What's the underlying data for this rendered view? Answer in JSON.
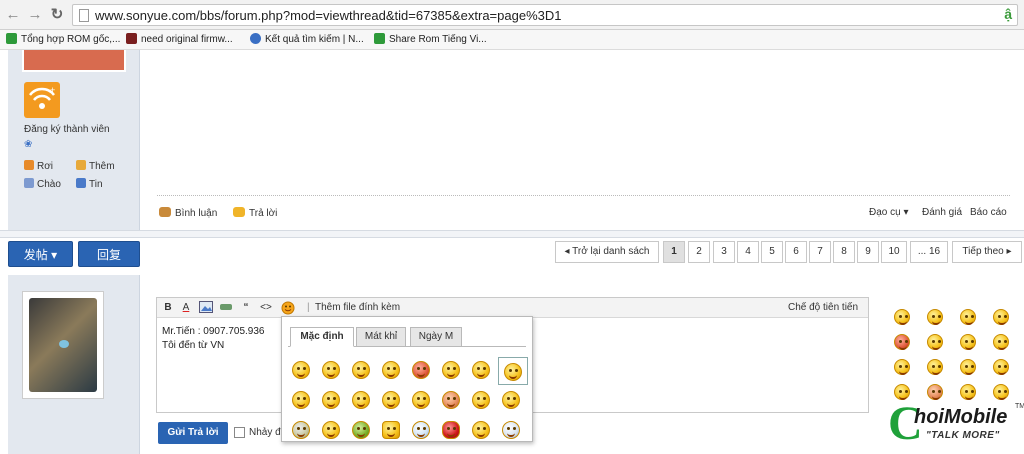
{
  "browser": {
    "url": "www.sonyue.com/bbs/forum.php?mod=viewthread&tid=67385&extra=page%3D1",
    "back_icon": "←",
    "forward_icon": "→",
    "reload_icon": "↻",
    "extension_icon": "ậ"
  },
  "bookmarks": [
    {
      "label": "Tổng hợp ROM gốc,...",
      "color": "#2e9a3a"
    },
    {
      "label": "need original firmw...",
      "color": "#7a1f1f"
    },
    {
      "label": "Kết quả tìm kiếm | N...",
      "color": "#3a6fc4"
    },
    {
      "label": "Share Rom Tiếng Vi...",
      "color": "#2e9a3a"
    }
  ],
  "sidebar": {
    "register_label": "Đăng ký thành viên",
    "flower_icon": "❀",
    "links": [
      "Rơi",
      "Thêm",
      "Chào",
      "Tin"
    ]
  },
  "post_actions": {
    "comment": "Bình luận",
    "reply": "Trả lời",
    "tools": "Đạo cụ",
    "tools_arrow": "▾",
    "rate": "Đánh giá",
    "report": "Báo cáo"
  },
  "buttons": {
    "new_post": "发帖",
    "new_post_arrow": "▾",
    "reply": "回复"
  },
  "pagination": {
    "back_arrow": "◂",
    "back_label": "Trở lại danh sách",
    "pages": [
      "1",
      "2",
      "3",
      "4",
      "5",
      "6",
      "7",
      "8",
      "9",
      "10",
      "... 16"
    ],
    "next_label": "Tiếp theo",
    "next_arrow": "▸"
  },
  "editor": {
    "toolbar": {
      "bold": "B",
      "font_color": "A",
      "quote": "“",
      "code": "<>",
      "attach_label": "Thêm file đính kèm",
      "advanced_label": "Chế độ tiên tiến"
    },
    "lines": [
      "Mr.Tiến : 0907.705.936",
      "Tôi đến từ VN"
    ]
  },
  "smiley_popup": {
    "tabs": [
      "Mặc định",
      "Mát khỉ",
      "Ngày M"
    ],
    "active_tab": 0
  },
  "submit": {
    "label": "Gửi Trả lời",
    "checkbox_label": "Nhảy đến"
  },
  "logo": {
    "mark": "C",
    "name": "hoiMobile",
    "tm": "TM",
    "tagline": "\"TALK MORE\""
  },
  "colors": {
    "accent_blue": "#2a64b3",
    "sidebar_bg": "#e3e8ef",
    "logo_green": "#1fa13a"
  }
}
